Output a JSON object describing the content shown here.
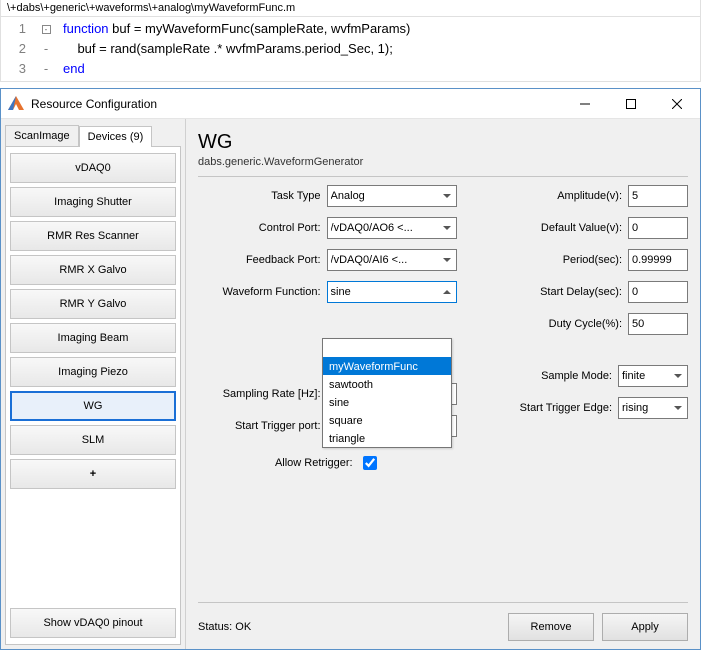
{
  "editor": {
    "path": "\\+dabs\\+generic\\+waveforms\\+analog\\myWaveformFunc.m",
    "gutter": [
      "1",
      "2",
      "3"
    ],
    "fold": [
      "⊟",
      "-",
      "-"
    ],
    "line1_kw": "function",
    "line1_rest": " buf = myWaveformFunc(sampleRate, wvfmParams)",
    "line2": "    buf = rand(sampleRate .* wvfmParams.period_Sec, 1);",
    "line3_kw": "end"
  },
  "window": {
    "title": "Resource Configuration"
  },
  "tabs": {
    "scanimage": "ScanImage",
    "devices": "Devices (9)"
  },
  "devices": [
    "vDAQ0",
    "Imaging Shutter",
    "RMR Res Scanner",
    "RMR X Galvo",
    "RMR Y Galvo",
    "Imaging Beam",
    "Imaging Piezo",
    "WG",
    "SLM"
  ],
  "add_device": "+",
  "show_pinout": "Show vDAQ0 pinout",
  "panel": {
    "title": "WG",
    "subtitle": "dabs.generic.WaveformGenerator",
    "leftLabels": {
      "taskType": "Task Type",
      "controlPort": "Control Port:",
      "feedbackPort": "Feedback Port:",
      "waveformFunction": "Waveform Function:",
      "samplingRate": "Sampling Rate [Hz]:",
      "startTriggerPort": "Start Trigger port:",
      "allowRetrigger": "Allow Retrigger:"
    },
    "leftValues": {
      "taskType": "Analog",
      "controlPort": "/vDAQ0/AO6 <...",
      "feedbackPort": "/vDAQ0/AI6 <...",
      "waveformFunction": "sine",
      "samplingRate": "",
      "startTriggerPort": ""
    },
    "rightLabels": {
      "amplitude": "Amplitude(v):",
      "defaultValue": "Default Value(v):",
      "period": "Period(sec):",
      "startDelay": "Start Delay(sec):",
      "dutyCycle": "Duty Cycle(%):",
      "sampleMode": "Sample Mode:",
      "startTriggerEdge": "Start Trigger Edge:"
    },
    "rightValues": {
      "amplitude": "5",
      "defaultValue": "0",
      "period": "0.99999",
      "startDelay": "0",
      "dutyCycle": "50",
      "sampleMode": "finite",
      "startTriggerEdge": "rising"
    },
    "dropdownItems": {
      "selected": "myWaveformFunc",
      "i1": "sawtooth",
      "i2": "sine",
      "i3": "square",
      "i4": "triangle"
    },
    "status": "Status: OK",
    "remove": "Remove",
    "apply": "Apply"
  }
}
